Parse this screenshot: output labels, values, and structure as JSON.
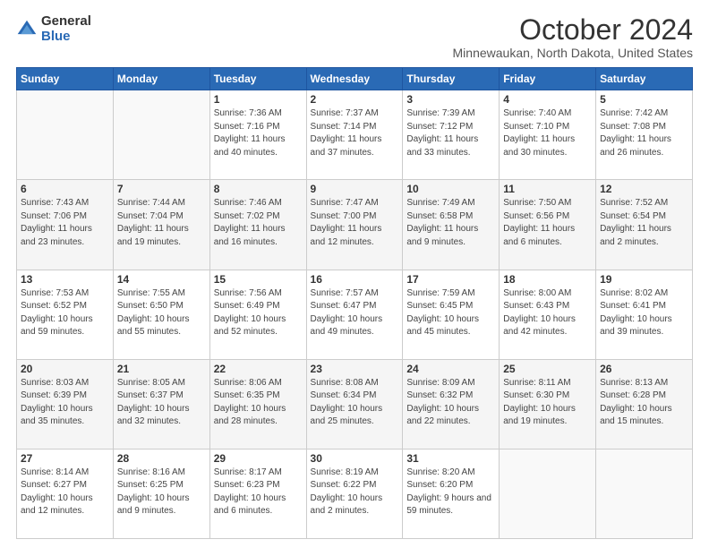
{
  "logo": {
    "general": "General",
    "blue": "Blue"
  },
  "header": {
    "title": "October 2024",
    "subtitle": "Minnewaukan, North Dakota, United States"
  },
  "weekdays": [
    "Sunday",
    "Monday",
    "Tuesday",
    "Wednesday",
    "Thursday",
    "Friday",
    "Saturday"
  ],
  "weeks": [
    [
      {
        "day": "",
        "sunrise": "",
        "sunset": "",
        "daylight": ""
      },
      {
        "day": "",
        "sunrise": "",
        "sunset": "",
        "daylight": ""
      },
      {
        "day": "1",
        "sunrise": "Sunrise: 7:36 AM",
        "sunset": "Sunset: 7:16 PM",
        "daylight": "Daylight: 11 hours and 40 minutes."
      },
      {
        "day": "2",
        "sunrise": "Sunrise: 7:37 AM",
        "sunset": "Sunset: 7:14 PM",
        "daylight": "Daylight: 11 hours and 37 minutes."
      },
      {
        "day": "3",
        "sunrise": "Sunrise: 7:39 AM",
        "sunset": "Sunset: 7:12 PM",
        "daylight": "Daylight: 11 hours and 33 minutes."
      },
      {
        "day": "4",
        "sunrise": "Sunrise: 7:40 AM",
        "sunset": "Sunset: 7:10 PM",
        "daylight": "Daylight: 11 hours and 30 minutes."
      },
      {
        "day": "5",
        "sunrise": "Sunrise: 7:42 AM",
        "sunset": "Sunset: 7:08 PM",
        "daylight": "Daylight: 11 hours and 26 minutes."
      }
    ],
    [
      {
        "day": "6",
        "sunrise": "Sunrise: 7:43 AM",
        "sunset": "Sunset: 7:06 PM",
        "daylight": "Daylight: 11 hours and 23 minutes."
      },
      {
        "day": "7",
        "sunrise": "Sunrise: 7:44 AM",
        "sunset": "Sunset: 7:04 PM",
        "daylight": "Daylight: 11 hours and 19 minutes."
      },
      {
        "day": "8",
        "sunrise": "Sunrise: 7:46 AM",
        "sunset": "Sunset: 7:02 PM",
        "daylight": "Daylight: 11 hours and 16 minutes."
      },
      {
        "day": "9",
        "sunrise": "Sunrise: 7:47 AM",
        "sunset": "Sunset: 7:00 PM",
        "daylight": "Daylight: 11 hours and 12 minutes."
      },
      {
        "day": "10",
        "sunrise": "Sunrise: 7:49 AM",
        "sunset": "Sunset: 6:58 PM",
        "daylight": "Daylight: 11 hours and 9 minutes."
      },
      {
        "day": "11",
        "sunrise": "Sunrise: 7:50 AM",
        "sunset": "Sunset: 6:56 PM",
        "daylight": "Daylight: 11 hours and 6 minutes."
      },
      {
        "day": "12",
        "sunrise": "Sunrise: 7:52 AM",
        "sunset": "Sunset: 6:54 PM",
        "daylight": "Daylight: 11 hours and 2 minutes."
      }
    ],
    [
      {
        "day": "13",
        "sunrise": "Sunrise: 7:53 AM",
        "sunset": "Sunset: 6:52 PM",
        "daylight": "Daylight: 10 hours and 59 minutes."
      },
      {
        "day": "14",
        "sunrise": "Sunrise: 7:55 AM",
        "sunset": "Sunset: 6:50 PM",
        "daylight": "Daylight: 10 hours and 55 minutes."
      },
      {
        "day": "15",
        "sunrise": "Sunrise: 7:56 AM",
        "sunset": "Sunset: 6:49 PM",
        "daylight": "Daylight: 10 hours and 52 minutes."
      },
      {
        "day": "16",
        "sunrise": "Sunrise: 7:57 AM",
        "sunset": "Sunset: 6:47 PM",
        "daylight": "Daylight: 10 hours and 49 minutes."
      },
      {
        "day": "17",
        "sunrise": "Sunrise: 7:59 AM",
        "sunset": "Sunset: 6:45 PM",
        "daylight": "Daylight: 10 hours and 45 minutes."
      },
      {
        "day": "18",
        "sunrise": "Sunrise: 8:00 AM",
        "sunset": "Sunset: 6:43 PM",
        "daylight": "Daylight: 10 hours and 42 minutes."
      },
      {
        "day": "19",
        "sunrise": "Sunrise: 8:02 AM",
        "sunset": "Sunset: 6:41 PM",
        "daylight": "Daylight: 10 hours and 39 minutes."
      }
    ],
    [
      {
        "day": "20",
        "sunrise": "Sunrise: 8:03 AM",
        "sunset": "Sunset: 6:39 PM",
        "daylight": "Daylight: 10 hours and 35 minutes."
      },
      {
        "day": "21",
        "sunrise": "Sunrise: 8:05 AM",
        "sunset": "Sunset: 6:37 PM",
        "daylight": "Daylight: 10 hours and 32 minutes."
      },
      {
        "day": "22",
        "sunrise": "Sunrise: 8:06 AM",
        "sunset": "Sunset: 6:35 PM",
        "daylight": "Daylight: 10 hours and 28 minutes."
      },
      {
        "day": "23",
        "sunrise": "Sunrise: 8:08 AM",
        "sunset": "Sunset: 6:34 PM",
        "daylight": "Daylight: 10 hours and 25 minutes."
      },
      {
        "day": "24",
        "sunrise": "Sunrise: 8:09 AM",
        "sunset": "Sunset: 6:32 PM",
        "daylight": "Daylight: 10 hours and 22 minutes."
      },
      {
        "day": "25",
        "sunrise": "Sunrise: 8:11 AM",
        "sunset": "Sunset: 6:30 PM",
        "daylight": "Daylight: 10 hours and 19 minutes."
      },
      {
        "day": "26",
        "sunrise": "Sunrise: 8:13 AM",
        "sunset": "Sunset: 6:28 PM",
        "daylight": "Daylight: 10 hours and 15 minutes."
      }
    ],
    [
      {
        "day": "27",
        "sunrise": "Sunrise: 8:14 AM",
        "sunset": "Sunset: 6:27 PM",
        "daylight": "Daylight: 10 hours and 12 minutes."
      },
      {
        "day": "28",
        "sunrise": "Sunrise: 8:16 AM",
        "sunset": "Sunset: 6:25 PM",
        "daylight": "Daylight: 10 hours and 9 minutes."
      },
      {
        "day": "29",
        "sunrise": "Sunrise: 8:17 AM",
        "sunset": "Sunset: 6:23 PM",
        "daylight": "Daylight: 10 hours and 6 minutes."
      },
      {
        "day": "30",
        "sunrise": "Sunrise: 8:19 AM",
        "sunset": "Sunset: 6:22 PM",
        "daylight": "Daylight: 10 hours and 2 minutes."
      },
      {
        "day": "31",
        "sunrise": "Sunrise: 8:20 AM",
        "sunset": "Sunset: 6:20 PM",
        "daylight": "Daylight: 9 hours and 59 minutes."
      },
      {
        "day": "",
        "sunrise": "",
        "sunset": "",
        "daylight": ""
      },
      {
        "day": "",
        "sunrise": "",
        "sunset": "",
        "daylight": ""
      }
    ]
  ]
}
